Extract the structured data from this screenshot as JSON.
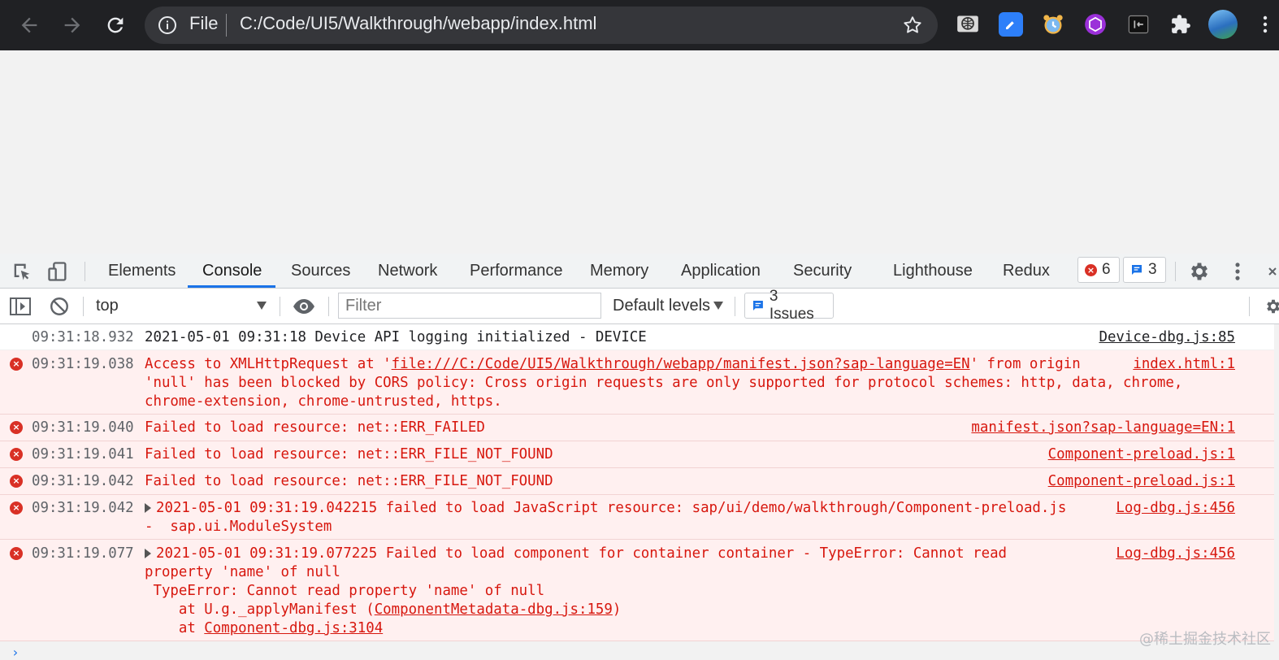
{
  "browser": {
    "omnibox": {
      "scheme_label": "File",
      "url": "C:/Code/UI5/Walkthrough/webapp/index.html"
    }
  },
  "devtools": {
    "tabs": [
      "Elements",
      "Console",
      "Sources",
      "Network",
      "Performance",
      "Memory",
      "Application",
      "Security",
      "Lighthouse",
      "Redux"
    ],
    "active_tab": "Console",
    "error_count": "6",
    "message_count": "3"
  },
  "console_toolbar": {
    "context": "top",
    "filter_placeholder": "Filter",
    "levels": "Default levels",
    "issues": "3 Issues"
  },
  "log": [
    {
      "level": "info",
      "time": "09:31:18.932",
      "message": "2021-05-01 09:31:18 Device API logging initialized - DEVICE",
      "source": "Device-dbg.js:85"
    },
    {
      "level": "error",
      "time": "09:31:19.038",
      "line1_pre": "Access to XMLHttpRequest at '",
      "line1_link": "file:///C:/Code/UI5/Walkthrough/webapp/manifest.json?sap-language=EN",
      "line1_post": "' from origin",
      "line2": "'null' has been blocked by CORS policy: Cross origin requests are only supported for protocol schemes: http, data, chrome,",
      "line3": "chrome-extension, chrome-untrusted, https.",
      "source": "index.html:1"
    },
    {
      "level": "error",
      "time": "09:31:19.040",
      "message": "Failed to load resource: net::ERR_FAILED",
      "source": "manifest.json?sap-language=EN:1"
    },
    {
      "level": "error",
      "time": "09:31:19.041",
      "message": "Failed to load resource: net::ERR_FILE_NOT_FOUND",
      "source": "Component-preload.js:1"
    },
    {
      "level": "error",
      "time": "09:31:19.042",
      "message": "Failed to load resource: net::ERR_FILE_NOT_FOUND",
      "source": "Component-preload.js:1"
    },
    {
      "level": "error",
      "time": "09:31:19.042",
      "line1": "2021-05-01 09:31:19.042215 failed to load JavaScript resource: sap/ui/demo/walkthrough/Component-preload.js",
      "line2": "-  sap.ui.ModuleSystem",
      "source": "Log-dbg.js:456"
    },
    {
      "level": "error",
      "time": "09:31:19.077",
      "line1": "2021-05-01 09:31:19.077225 Failed to load component for container container - TypeError: Cannot read",
      "line2": "property 'name' of null",
      "line3": " TypeError: Cannot read property 'name' of null",
      "line4_pre": "    at U.g._applyManifest (",
      "line4_link": "ComponentMetadata-dbg.js:159",
      "line4_post": ")",
      "line5_pre": "    at ",
      "line5_link": "Component-dbg.js:3104",
      "source": "Log-dbg.js:456"
    }
  ],
  "prompt_symbol": "›",
  "watermark": "@稀土掘金技术社区"
}
